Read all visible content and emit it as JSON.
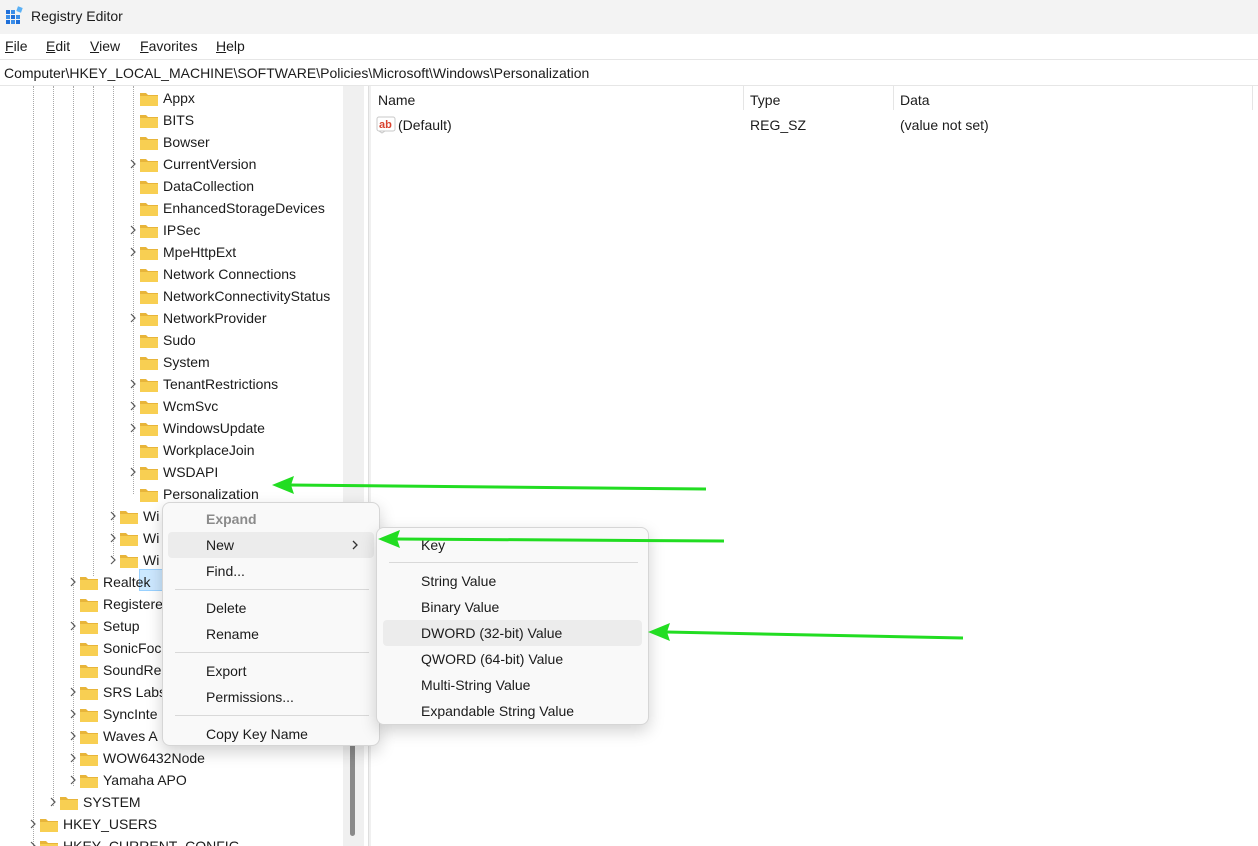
{
  "window": {
    "title": "Registry Editor",
    "icon": "regedit-icon"
  },
  "menu": [
    {
      "label": "File",
      "ul": "F",
      "rest": "ile"
    },
    {
      "label": "Edit",
      "ul": "E",
      "rest": "dit"
    },
    {
      "label": "View",
      "ul": "V",
      "rest": "iew"
    },
    {
      "label": "Favorites",
      "ul": "F",
      "rest": "avorites",
      "pre": "",
      "ulIndex": 1
    },
    {
      "label": "Help",
      "ul": "H",
      "rest": "elp"
    }
  ],
  "address": "Computer\\HKEY_LOCAL_MACHINE\\SOFTWARE\\Policies\\Microsoft\\Windows\\Personalization",
  "tree": {
    "items": [
      {
        "label": "Appx",
        "expandable": false
      },
      {
        "label": "BITS",
        "expandable": false
      },
      {
        "label": "Bowser",
        "expandable": false
      },
      {
        "label": "CurrentVersion",
        "expandable": true
      },
      {
        "label": "DataCollection",
        "expandable": false
      },
      {
        "label": "EnhancedStorageDevices",
        "expandable": false
      },
      {
        "label": "IPSec",
        "expandable": true
      },
      {
        "label": "MpeHttpExt",
        "expandable": true
      },
      {
        "label": "Network Connections",
        "expandable": false
      },
      {
        "label": "NetworkConnectivityStatus",
        "expandable": false
      },
      {
        "label": "NetworkProvider",
        "expandable": true
      },
      {
        "label": "Sudo",
        "expandable": false
      },
      {
        "label": "System",
        "expandable": false
      },
      {
        "label": "TenantRestrictions",
        "expandable": true
      },
      {
        "label": "WcmSvc",
        "expandable": true
      },
      {
        "label": "WindowsUpdate",
        "expandable": true
      },
      {
        "label": "WorkplaceJoin",
        "expandable": false
      },
      {
        "label": "WSDAPI",
        "expandable": true
      },
      {
        "label": "Personalization",
        "expandable": false,
        "selected": true
      },
      {
        "label": "Wi",
        "expandable": true
      },
      {
        "label": "Wi",
        "expandable": true
      },
      {
        "label": "Wi",
        "expandable": true
      },
      {
        "label": "Realtek",
        "expandable": true
      },
      {
        "label": "Registere",
        "expandable": false
      },
      {
        "label": "Setup",
        "expandable": true
      },
      {
        "label": "SonicFoc",
        "expandable": false
      },
      {
        "label": "SoundRe",
        "expandable": false
      },
      {
        "label": "SRS Labs",
        "expandable": true
      },
      {
        "label": "SyncInte",
        "expandable": true
      },
      {
        "label": "Waves A",
        "expandable": true
      },
      {
        "label": "WOW6432Node",
        "expandable": true
      },
      {
        "label": "Yamaha APO",
        "expandable": true
      },
      {
        "label": "SYSTEM",
        "expandable": true
      },
      {
        "label": "HKEY_USERS",
        "expandable": true
      },
      {
        "label": "HKEY_CURRENT_CONFIG",
        "expandable": true
      }
    ]
  },
  "list": {
    "columns": {
      "name": "Name",
      "type": "Type",
      "data": "Data"
    },
    "rows": [
      {
        "icon": "string-value-icon",
        "name": "(Default)",
        "type": "REG_SZ",
        "data": "(value not set)"
      }
    ]
  },
  "context_menu": {
    "items": [
      {
        "label": "Expand",
        "disabled": true
      },
      {
        "label": "New",
        "has_submenu": true,
        "highlighted": true
      },
      {
        "label": "Find..."
      },
      {
        "label": "Delete"
      },
      {
        "label": "Rename"
      },
      {
        "label": "Export"
      },
      {
        "label": "Permissions..."
      },
      {
        "label": "Copy Key Name"
      }
    ]
  },
  "submenu": {
    "items": [
      {
        "label": "Key"
      },
      {
        "label": "String Value"
      },
      {
        "label": "Binary Value"
      },
      {
        "label": "DWORD (32-bit) Value",
        "highlighted": true
      },
      {
        "label": "QWORD (64-bit) Value"
      },
      {
        "label": "Multi-String Value"
      },
      {
        "label": "Expandable String Value"
      }
    ]
  },
  "colors": {
    "selection": "#cce8ff",
    "annotation_arrow": "#22dd22",
    "folder": "#f8cf52"
  }
}
